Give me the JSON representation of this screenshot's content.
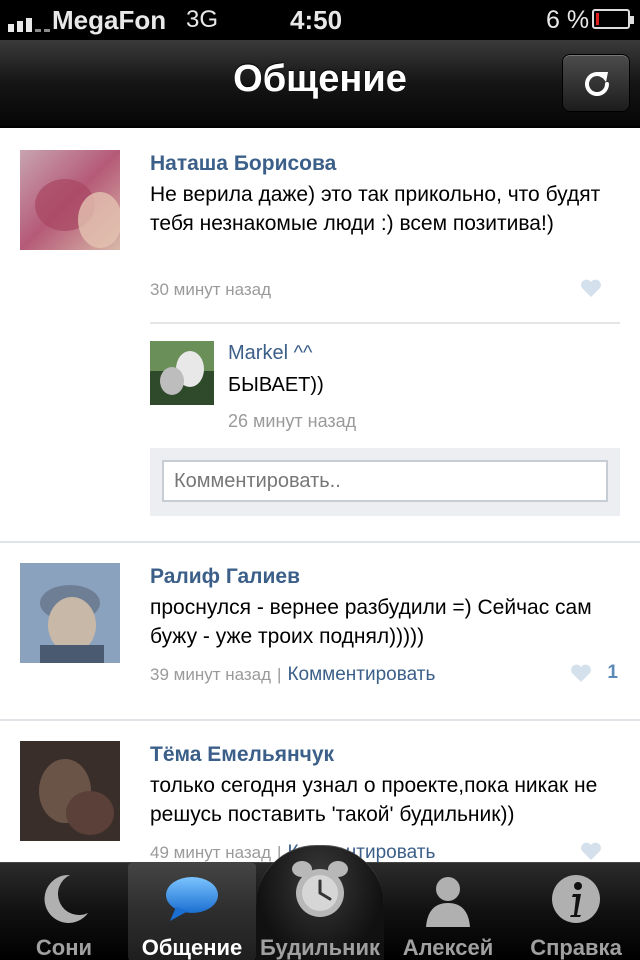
{
  "status_bar": {
    "carrier": "MegaFon",
    "network": "3G",
    "time": "4:50",
    "battery": "6 %",
    "battery_level": 0.06
  },
  "nav": {
    "title": "Общение",
    "refresh_icon": "refresh-icon"
  },
  "posts": [
    {
      "author": "Наташа Борисова",
      "text": "Не верила даже) это так прикольно, что будят тебя незнакомые люди :) всем позитива!)",
      "time": "30 минут назад",
      "reply": {
        "author": "Markel ^^",
        "text": "БЫВАЕТ))",
        "time": "26 минут назад"
      },
      "comment_placeholder": "Комментировать.."
    },
    {
      "author": "Ралиф Галиев",
      "text": "проснулся - вернее разбудили =) Сейчас сам бужу - уже троих поднял)))))",
      "time": "39 минут назад",
      "separator": "|",
      "comment_link": "Комментировать",
      "likes": "1"
    },
    {
      "author": "Тёма Емельянчук",
      "text": "только сегодня узнал о проекте,пока никак не решусь поставить 'такой' будильник))",
      "time": "49 минут назад",
      "separator": "|",
      "comment_link": "Комментировать"
    }
  ],
  "tabs": [
    {
      "label": "Сони",
      "icon": "moon-icon"
    },
    {
      "label": "Общение",
      "icon": "speech-bubble-icon"
    },
    {
      "label": "Будильник",
      "icon": "alarm-clock-icon"
    },
    {
      "label": "Алексей",
      "icon": "person-icon"
    },
    {
      "label": "Справка",
      "icon": "info-icon"
    }
  ],
  "colors": {
    "link": "#3b5f89",
    "timestamp": "#9a9a9a",
    "battery_low": "#e02020"
  }
}
